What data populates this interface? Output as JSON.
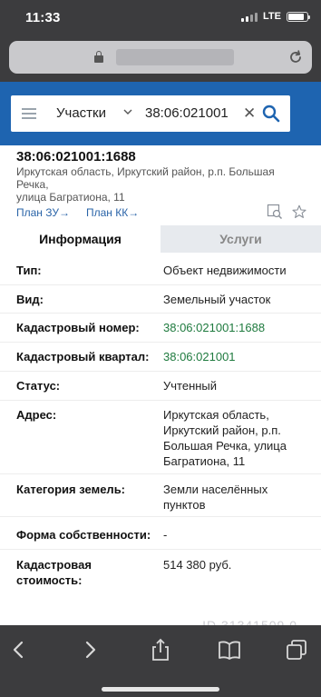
{
  "status_bar": {
    "time": "11:33",
    "network": "LTE",
    "battery_level": 0.85
  },
  "browser": {
    "lock_icon": "lock-icon",
    "reload_icon": "reload-icon"
  },
  "search": {
    "menu_icon": "menu-icon",
    "type": "Участки",
    "value": "38:06:021001",
    "clear_symbol": "✕",
    "search_icon": "search-icon"
  },
  "object": {
    "cadastral_number": "38:06:021001:1688",
    "address_line1": "Иркутская область, Иркутский район, р.п. Большая Речка,",
    "address_line2": "улица Багратиона, 11"
  },
  "links": {
    "plan_zu": "План ЗУ→",
    "plan_kk": "План КК→"
  },
  "tabs": {
    "info": "Информация",
    "services": "Услуги"
  },
  "details": [
    {
      "label": "Тип:",
      "value": "Объект недвижимости"
    },
    {
      "label": "Вид:",
      "value": "Земельный участок"
    },
    {
      "label": "Кадастровый номер:",
      "value": "38:06:021001:1688"
    },
    {
      "label": "Кадастровый квартал:",
      "value": "38:06:021001"
    },
    {
      "label": "Статус:",
      "value": "Учтенный"
    },
    {
      "label": "Адрес:",
      "value_lines": [
        "Иркутская область,",
        "Иркутский район, р.п.",
        "Большая Речка, улица",
        "Багратиона, 11"
      ]
    },
    {
      "label": "Категория земель:",
      "value_lines": [
        "Земли населённых",
        "пунктов"
      ]
    },
    {
      "label": "Форма собственности:",
      "value": "-"
    },
    {
      "label_lines": [
        "Кадастровая",
        "стоимость:"
      ],
      "value": "514 380 руб."
    }
  ],
  "watermark": "ID 31341509 0",
  "colors": {
    "brand_blue": "#1e64b0",
    "link_blue": "#2a64a8",
    "value_green": "#1e7a3e",
    "tab_inactive_bg": "#e7eaee"
  }
}
